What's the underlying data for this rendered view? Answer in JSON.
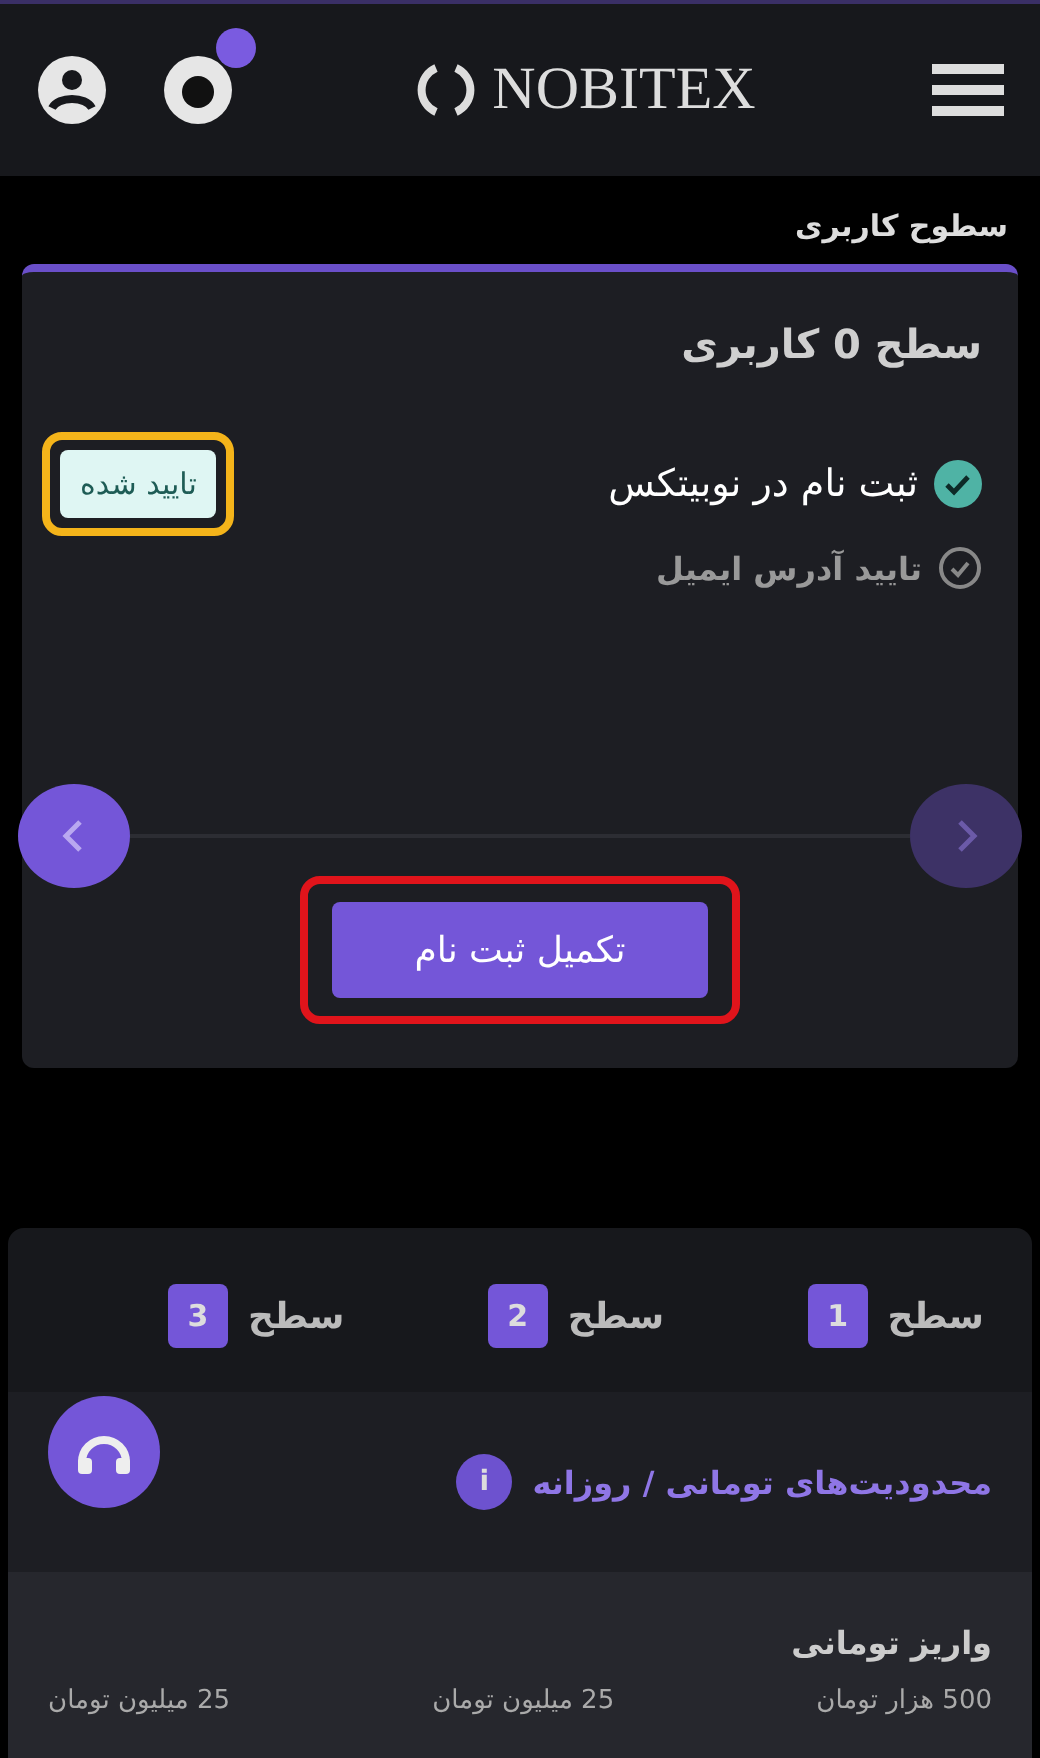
{
  "header": {
    "logo": "NOBITEX"
  },
  "section_title": "سطوح کاربری",
  "level_card": {
    "title": "سطح 0 کاربری",
    "steps": [
      {
        "label": "ثبت نام در نوبیتکس",
        "done": true,
        "status": "تایید شده"
      },
      {
        "label": "تایید آدرس ایمیل",
        "done": false
      }
    ],
    "button": "تکمیل ثبت نام"
  },
  "levels": [
    {
      "label": "سطح",
      "number": "1"
    },
    {
      "label": "سطح",
      "number": "2"
    },
    {
      "label": "سطح",
      "number": "3"
    }
  ],
  "limits": {
    "title": "محدودیت‌های تومانی / روزانه",
    "info": "i",
    "deposit_title": "واریز تومانی",
    "values": [
      "500 هزار تومان",
      "25 میلیون تومان",
      "25 میلیون تومان"
    ]
  }
}
